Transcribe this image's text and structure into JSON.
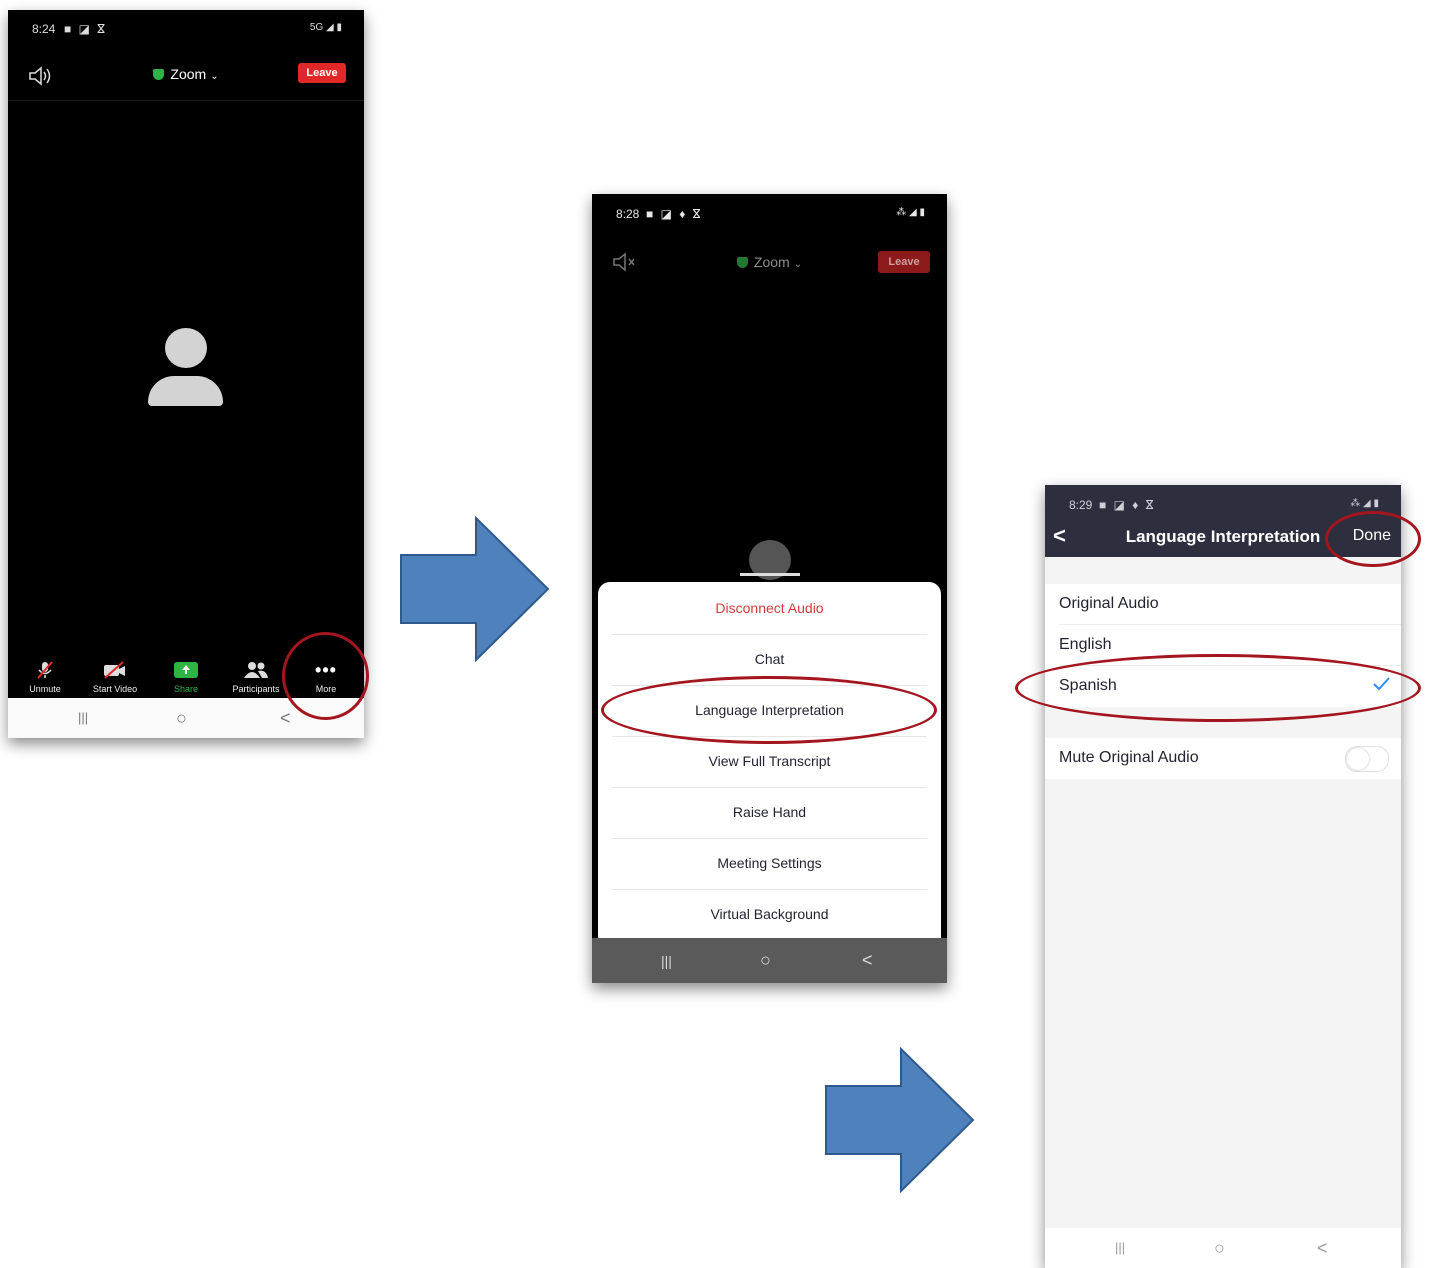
{
  "screen1": {
    "status": {
      "time": "8:24",
      "icons": "■ ◪ ⴵ",
      "network": "5G ◢ ▮"
    },
    "title": "Zoom",
    "leave_label": "Leave",
    "toolbar": [
      {
        "label": "Unmute",
        "icon": "muted-mic-icon"
      },
      {
        "label": "Start Video",
        "icon": "video-off-icon"
      },
      {
        "label": "Share",
        "icon": "share-arrow-icon"
      },
      {
        "label": "Participants",
        "icon": "participants-icon"
      },
      {
        "label": "More",
        "icon": "more-dots-icon"
      }
    ],
    "nav": {
      "recents": "|||",
      "home": "○",
      "back": "<"
    }
  },
  "screen2": {
    "status": {
      "time": "8:28",
      "icons": "■ ◪ ♦ ⴵ",
      "network": "⁂ ◢ ▮"
    },
    "title": "Zoom",
    "leave_label": "Leave",
    "menu": [
      "Disconnect Audio",
      "Chat",
      "Language Interpretation",
      "View Full Transcript",
      "Raise Hand",
      "Meeting Settings",
      "Virtual Background"
    ],
    "nav": {
      "recents": "|||",
      "home": "○",
      "back": "<"
    }
  },
  "screen3": {
    "status": {
      "time": "8:29",
      "icons": "■ ◪ ♦ ⴵ",
      "network": "⁂ ◢ ▮"
    },
    "title": "Language Interpretation",
    "back": "<",
    "done_label": "Done",
    "options": [
      "Original Audio",
      "English",
      "Spanish"
    ],
    "selected": "Spanish",
    "mute_label": "Mute Original Audio",
    "mute_on": false,
    "nav": {
      "recents": "|||",
      "home": "○",
      "back": "<"
    }
  },
  "colors": {
    "leave": "#e02828",
    "share_green": "#2fb344",
    "header_dark": "#2d2e3e",
    "annotation_red": "#a4161f",
    "arrow_blue": "#4f81bd",
    "check_blue": "#2d8cff"
  }
}
